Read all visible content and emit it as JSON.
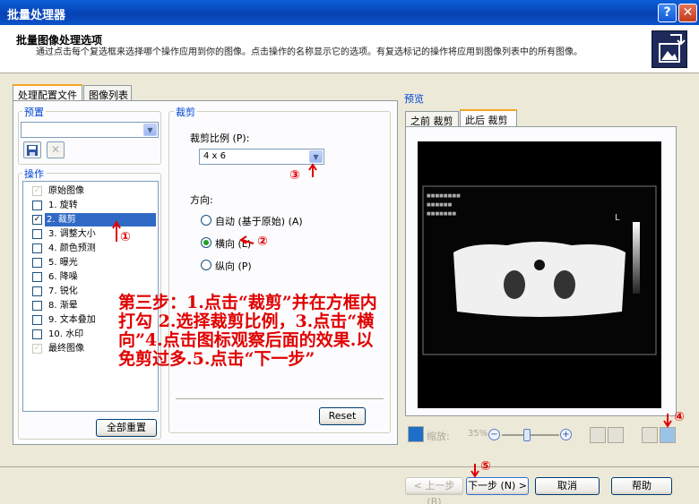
{
  "window": {
    "title": "批量处理器",
    "help_glyph": "?",
    "close_glyph": "✕"
  },
  "header": {
    "title": "批量图像处理选项",
    "description": "通过点击每个复选框来选择哪个操作应用到你的图像。点击操作的名称显示它的选项。有复选标记的操作将应用到图像列表中的所有图像。"
  },
  "tabs": [
    {
      "label": "处理配置文件",
      "active": true
    },
    {
      "label": "图像列表",
      "active": false
    }
  ],
  "preset": {
    "label": "预置",
    "value": ""
  },
  "actions": {
    "label": "操作",
    "items": [
      {
        "label": "原始图像",
        "check": "✓",
        "state": "disabled"
      },
      {
        "label": "1. 旋转",
        "check": "",
        "state": "normal"
      },
      {
        "label": "2. 裁剪",
        "check": "✓",
        "state": "selected"
      },
      {
        "label": "3. 调整大小",
        "check": "",
        "state": "normal"
      },
      {
        "label": "4. 颜色预测",
        "check": "",
        "state": "normal"
      },
      {
        "label": "5. 曝光",
        "check": "",
        "state": "normal"
      },
      {
        "label": "6. 降噪",
        "check": "",
        "state": "normal"
      },
      {
        "label": "7. 锐化",
        "check": "",
        "state": "normal"
      },
      {
        "label": "8. 渐晕",
        "check": "",
        "state": "normal"
      },
      {
        "label": "9. 文本叠加",
        "check": "",
        "state": "normal"
      },
      {
        "label": "10. 水印",
        "check": "",
        "state": "normal"
      },
      {
        "label": "最终图像",
        "check": "✓",
        "state": "disabled"
      }
    ],
    "reset_all_label": "全部重置"
  },
  "crop": {
    "group_label": "裁剪",
    "ratio_label": "裁剪比例 (P):",
    "ratio_value": "4 x 6",
    "orientation_label": "方向:",
    "options": [
      {
        "label": "自动 (基于原始) (A)",
        "selected": false
      },
      {
        "label": "横向 (L)",
        "selected": true
      },
      {
        "label": "纵向 (P)",
        "selected": false
      }
    ],
    "reset_label": "Reset"
  },
  "preview": {
    "label": "预览",
    "tabs": [
      {
        "label": "之前 裁剪",
        "active": false
      },
      {
        "label": "此后 裁剪",
        "active": true
      }
    ],
    "zoom_label": "缩放:",
    "zoom_value": "35%",
    "scan_letter": "L"
  },
  "footer": {
    "prev_label": "< 上一步 (B)",
    "next_label": "下一步 (N) >",
    "cancel_label": "取消",
    "help_label": "帮助"
  },
  "annotations": {
    "step_text": "第三步：1.点击“裁剪”并在方框内打勾 2.选择裁剪比例，3.点击“横向”4.点击图标观察后面的效果.以免剪过多.5.点击“下一步”",
    "marker_1": "①",
    "marker_2": "②",
    "marker_3": "③",
    "marker_4": "④",
    "marker_5": "⑤"
  },
  "colors": {
    "title_bar": "#0842b4",
    "selection": "#316ac5",
    "annotation": "#e00000",
    "group_label": "#0046d5"
  }
}
